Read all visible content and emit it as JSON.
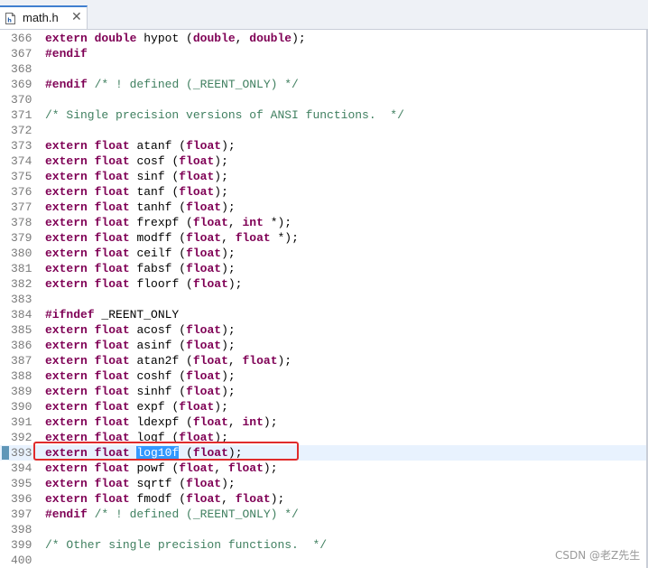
{
  "tab": {
    "title": "math.h",
    "close_glyph": "✕",
    "icon": "c-header-file-icon"
  },
  "colors": {
    "keyword": "#7f0055",
    "comment": "#3f7f5f",
    "selection": "#3399ff",
    "current_line": "#e8f2fe",
    "annotation_box": "#e02b2b"
  },
  "selected_text": "log10f",
  "lines": [
    {
      "num": "366",
      "tokens": [
        {
          "t": "kw",
          "v": "extern"
        },
        {
          "t": "tx",
          "v": " "
        },
        {
          "t": "kw",
          "v": "double"
        },
        {
          "t": "tx",
          "v": " hypot ("
        },
        {
          "t": "kw",
          "v": "double"
        },
        {
          "t": "tx",
          "v": ", "
        },
        {
          "t": "kw",
          "v": "double"
        },
        {
          "t": "tx",
          "v": ");"
        }
      ]
    },
    {
      "num": "367",
      "tokens": [
        {
          "t": "pp",
          "v": "#endif"
        }
      ]
    },
    {
      "num": "368",
      "tokens": []
    },
    {
      "num": "369",
      "tokens": [
        {
          "t": "pp",
          "v": "#endif"
        },
        {
          "t": "tx",
          "v": " "
        },
        {
          "t": "cm",
          "v": "/* ! defined (_REENT_ONLY) */"
        }
      ]
    },
    {
      "num": "370",
      "tokens": []
    },
    {
      "num": "371",
      "tokens": [
        {
          "t": "cm",
          "v": "/* Single precision versions of ANSI functions.  */"
        }
      ]
    },
    {
      "num": "372",
      "tokens": []
    },
    {
      "num": "373",
      "tokens": [
        {
          "t": "kw",
          "v": "extern"
        },
        {
          "t": "tx",
          "v": " "
        },
        {
          "t": "kw",
          "v": "float"
        },
        {
          "t": "tx",
          "v": " atanf ("
        },
        {
          "t": "kw",
          "v": "float"
        },
        {
          "t": "tx",
          "v": ");"
        }
      ]
    },
    {
      "num": "374",
      "tokens": [
        {
          "t": "kw",
          "v": "extern"
        },
        {
          "t": "tx",
          "v": " "
        },
        {
          "t": "kw",
          "v": "float"
        },
        {
          "t": "tx",
          "v": " cosf ("
        },
        {
          "t": "kw",
          "v": "float"
        },
        {
          "t": "tx",
          "v": ");"
        }
      ]
    },
    {
      "num": "375",
      "tokens": [
        {
          "t": "kw",
          "v": "extern"
        },
        {
          "t": "tx",
          "v": " "
        },
        {
          "t": "kw",
          "v": "float"
        },
        {
          "t": "tx",
          "v": " sinf ("
        },
        {
          "t": "kw",
          "v": "float"
        },
        {
          "t": "tx",
          "v": ");"
        }
      ]
    },
    {
      "num": "376",
      "tokens": [
        {
          "t": "kw",
          "v": "extern"
        },
        {
          "t": "tx",
          "v": " "
        },
        {
          "t": "kw",
          "v": "float"
        },
        {
          "t": "tx",
          "v": " tanf ("
        },
        {
          "t": "kw",
          "v": "float"
        },
        {
          "t": "tx",
          "v": ");"
        }
      ]
    },
    {
      "num": "377",
      "tokens": [
        {
          "t": "kw",
          "v": "extern"
        },
        {
          "t": "tx",
          "v": " "
        },
        {
          "t": "kw",
          "v": "float"
        },
        {
          "t": "tx",
          "v": " tanhf ("
        },
        {
          "t": "kw",
          "v": "float"
        },
        {
          "t": "tx",
          "v": ");"
        }
      ]
    },
    {
      "num": "378",
      "tokens": [
        {
          "t": "kw",
          "v": "extern"
        },
        {
          "t": "tx",
          "v": " "
        },
        {
          "t": "kw",
          "v": "float"
        },
        {
          "t": "tx",
          "v": " frexpf ("
        },
        {
          "t": "kw",
          "v": "float"
        },
        {
          "t": "tx",
          "v": ", "
        },
        {
          "t": "kw",
          "v": "int"
        },
        {
          "t": "tx",
          "v": " *);"
        }
      ]
    },
    {
      "num": "379",
      "tokens": [
        {
          "t": "kw",
          "v": "extern"
        },
        {
          "t": "tx",
          "v": " "
        },
        {
          "t": "kw",
          "v": "float"
        },
        {
          "t": "tx",
          "v": " modff ("
        },
        {
          "t": "kw",
          "v": "float"
        },
        {
          "t": "tx",
          "v": ", "
        },
        {
          "t": "kw",
          "v": "float"
        },
        {
          "t": "tx",
          "v": " *);"
        }
      ]
    },
    {
      "num": "380",
      "tokens": [
        {
          "t": "kw",
          "v": "extern"
        },
        {
          "t": "tx",
          "v": " "
        },
        {
          "t": "kw",
          "v": "float"
        },
        {
          "t": "tx",
          "v": " ceilf ("
        },
        {
          "t": "kw",
          "v": "float"
        },
        {
          "t": "tx",
          "v": ");"
        }
      ]
    },
    {
      "num": "381",
      "tokens": [
        {
          "t": "kw",
          "v": "extern"
        },
        {
          "t": "tx",
          "v": " "
        },
        {
          "t": "kw",
          "v": "float"
        },
        {
          "t": "tx",
          "v": " fabsf ("
        },
        {
          "t": "kw",
          "v": "float"
        },
        {
          "t": "tx",
          "v": ");"
        }
      ]
    },
    {
      "num": "382",
      "tokens": [
        {
          "t": "kw",
          "v": "extern"
        },
        {
          "t": "tx",
          "v": " "
        },
        {
          "t": "kw",
          "v": "float"
        },
        {
          "t": "tx",
          "v": " floorf ("
        },
        {
          "t": "kw",
          "v": "float"
        },
        {
          "t": "tx",
          "v": ");"
        }
      ]
    },
    {
      "num": "383",
      "tokens": []
    },
    {
      "num": "384",
      "tokens": [
        {
          "t": "pp",
          "v": "#ifndef"
        },
        {
          "t": "tx",
          "v": " _REENT_ONLY"
        }
      ]
    },
    {
      "num": "385",
      "tokens": [
        {
          "t": "kw",
          "v": "extern"
        },
        {
          "t": "tx",
          "v": " "
        },
        {
          "t": "kw",
          "v": "float"
        },
        {
          "t": "tx",
          "v": " acosf ("
        },
        {
          "t": "kw",
          "v": "float"
        },
        {
          "t": "tx",
          "v": ");"
        }
      ]
    },
    {
      "num": "386",
      "tokens": [
        {
          "t": "kw",
          "v": "extern"
        },
        {
          "t": "tx",
          "v": " "
        },
        {
          "t": "kw",
          "v": "float"
        },
        {
          "t": "tx",
          "v": " asinf ("
        },
        {
          "t": "kw",
          "v": "float"
        },
        {
          "t": "tx",
          "v": ");"
        }
      ]
    },
    {
      "num": "387",
      "tokens": [
        {
          "t": "kw",
          "v": "extern"
        },
        {
          "t": "tx",
          "v": " "
        },
        {
          "t": "kw",
          "v": "float"
        },
        {
          "t": "tx",
          "v": " atan2f ("
        },
        {
          "t": "kw",
          "v": "float"
        },
        {
          "t": "tx",
          "v": ", "
        },
        {
          "t": "kw",
          "v": "float"
        },
        {
          "t": "tx",
          "v": ");"
        }
      ]
    },
    {
      "num": "388",
      "tokens": [
        {
          "t": "kw",
          "v": "extern"
        },
        {
          "t": "tx",
          "v": " "
        },
        {
          "t": "kw",
          "v": "float"
        },
        {
          "t": "tx",
          "v": " coshf ("
        },
        {
          "t": "kw",
          "v": "float"
        },
        {
          "t": "tx",
          "v": ");"
        }
      ]
    },
    {
      "num": "389",
      "tokens": [
        {
          "t": "kw",
          "v": "extern"
        },
        {
          "t": "tx",
          "v": " "
        },
        {
          "t": "kw",
          "v": "float"
        },
        {
          "t": "tx",
          "v": " sinhf ("
        },
        {
          "t": "kw",
          "v": "float"
        },
        {
          "t": "tx",
          "v": ");"
        }
      ]
    },
    {
      "num": "390",
      "tokens": [
        {
          "t": "kw",
          "v": "extern"
        },
        {
          "t": "tx",
          "v": " "
        },
        {
          "t": "kw",
          "v": "float"
        },
        {
          "t": "tx",
          "v": " expf ("
        },
        {
          "t": "kw",
          "v": "float"
        },
        {
          "t": "tx",
          "v": ");"
        }
      ]
    },
    {
      "num": "391",
      "tokens": [
        {
          "t": "kw",
          "v": "extern"
        },
        {
          "t": "tx",
          "v": " "
        },
        {
          "t": "kw",
          "v": "float"
        },
        {
          "t": "tx",
          "v": " ldexpf ("
        },
        {
          "t": "kw",
          "v": "float"
        },
        {
          "t": "tx",
          "v": ", "
        },
        {
          "t": "kw",
          "v": "int"
        },
        {
          "t": "tx",
          "v": ");"
        }
      ]
    },
    {
      "num": "392",
      "tokens": [
        {
          "t": "kw",
          "v": "extern"
        },
        {
          "t": "tx",
          "v": " "
        },
        {
          "t": "kw",
          "v": "float"
        },
        {
          "t": "tx",
          "v": " logf ("
        },
        {
          "t": "kw",
          "v": "float"
        },
        {
          "t": "tx",
          "v": ");"
        }
      ]
    },
    {
      "num": "393",
      "current": true,
      "tokens": [
        {
          "t": "kw",
          "v": "extern"
        },
        {
          "t": "tx",
          "v": " "
        },
        {
          "t": "kw",
          "v": "float"
        },
        {
          "t": "tx",
          "v": " "
        },
        {
          "t": "sel",
          "v": "log10f"
        },
        {
          "t": "tx",
          "v": " ("
        },
        {
          "t": "kw",
          "v": "float"
        },
        {
          "t": "tx",
          "v": ");"
        }
      ]
    },
    {
      "num": "394",
      "tokens": [
        {
          "t": "kw",
          "v": "extern"
        },
        {
          "t": "tx",
          "v": " "
        },
        {
          "t": "kw",
          "v": "float"
        },
        {
          "t": "tx",
          "v": " powf ("
        },
        {
          "t": "kw",
          "v": "float"
        },
        {
          "t": "tx",
          "v": ", "
        },
        {
          "t": "kw",
          "v": "float"
        },
        {
          "t": "tx",
          "v": ");"
        }
      ]
    },
    {
      "num": "395",
      "tokens": [
        {
          "t": "kw",
          "v": "extern"
        },
        {
          "t": "tx",
          "v": " "
        },
        {
          "t": "kw",
          "v": "float"
        },
        {
          "t": "tx",
          "v": " sqrtf ("
        },
        {
          "t": "kw",
          "v": "float"
        },
        {
          "t": "tx",
          "v": ");"
        }
      ]
    },
    {
      "num": "396",
      "tokens": [
        {
          "t": "kw",
          "v": "extern"
        },
        {
          "t": "tx",
          "v": " "
        },
        {
          "t": "kw",
          "v": "float"
        },
        {
          "t": "tx",
          "v": " fmodf ("
        },
        {
          "t": "kw",
          "v": "float"
        },
        {
          "t": "tx",
          "v": ", "
        },
        {
          "t": "kw",
          "v": "float"
        },
        {
          "t": "tx",
          "v": ");"
        }
      ]
    },
    {
      "num": "397",
      "tokens": [
        {
          "t": "pp",
          "v": "#endif"
        },
        {
          "t": "tx",
          "v": " "
        },
        {
          "t": "cm",
          "v": "/* ! defined (_REENT_ONLY) */"
        }
      ]
    },
    {
      "num": "398",
      "tokens": []
    },
    {
      "num": "399",
      "tokens": [
        {
          "t": "cm",
          "v": "/* Other single precision functions.  */"
        }
      ]
    },
    {
      "num": "400",
      "tokens": []
    }
  ],
  "watermark": "CSDN @老Z先生"
}
